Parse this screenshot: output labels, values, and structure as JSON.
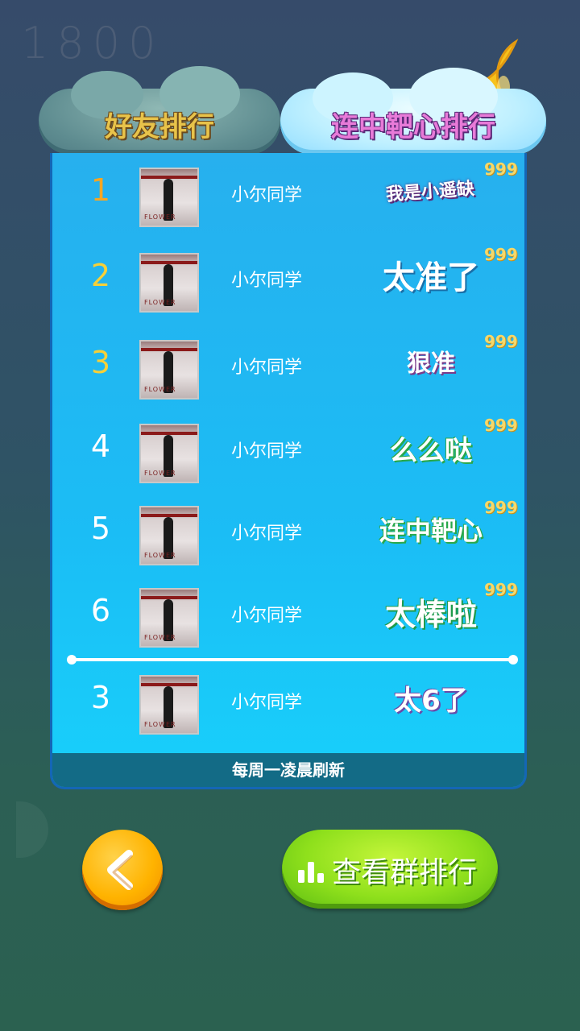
{
  "score": "1800",
  "tabs": [
    {
      "label": "好友排行",
      "active": false
    },
    {
      "label": "连中靶心排行",
      "active": true
    }
  ],
  "rows": [
    {
      "rank": "1",
      "name": "小尔同学",
      "title": "我是小遥缺",
      "count": "999"
    },
    {
      "rank": "2",
      "name": "小尔同学",
      "title": "太准了",
      "count": "999"
    },
    {
      "rank": "3",
      "name": "小尔同学",
      "title": "狠准",
      "count": "999"
    },
    {
      "rank": "4",
      "name": "小尔同学",
      "title": "么么哒",
      "count": "999"
    },
    {
      "rank": "5",
      "name": "小尔同学",
      "title": "连中靶心",
      "count": "999"
    },
    {
      "rank": "6",
      "name": "小尔同学",
      "title": "太棒啦",
      "count": "999"
    }
  ],
  "me": {
    "rank": "3",
    "name": "小尔同学",
    "title": "太6了"
  },
  "avatar_text": "FLOWER",
  "footer": "每周一凌晨刷新",
  "buttons": {
    "group_rank": "查看群排行"
  },
  "colors": {
    "panel": "#1bbdf5",
    "rank1": "#f5a623",
    "rank2_3": "#f7d038",
    "count": "#f5d86a"
  }
}
